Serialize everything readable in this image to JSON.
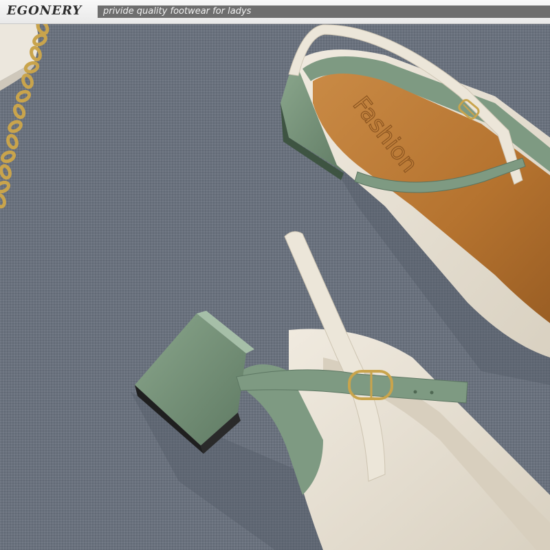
{
  "banner": {
    "brand": "EGONERY",
    "tagline": "privide quality footwear for ladys"
  },
  "photo": {
    "insole_print": "Fashion",
    "colors": {
      "background_fabric": "#6f7782",
      "cream_leather": "#e8e1d3",
      "sage_green_leather": "#7e9a82",
      "tan_insole": "#b97b3c",
      "gold_chain": "#c7a24a"
    }
  }
}
